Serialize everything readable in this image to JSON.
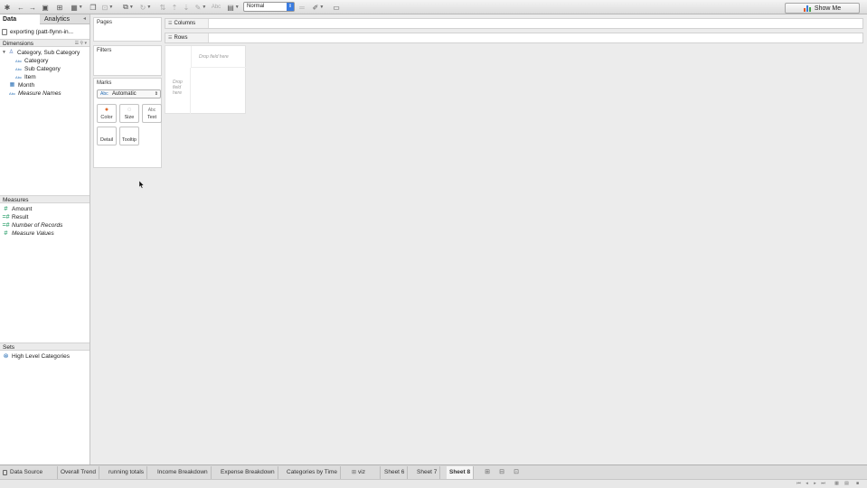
{
  "toolbar": {
    "fit_value": "Normal",
    "show_me_label": "Show Me",
    "abc_label": "Abc",
    "colors": {
      "accent": "#3b7ce0",
      "bar1": "#e05a2b",
      "bar2": "#3a7dd8",
      "bar3": "#4aa04a"
    }
  },
  "data_pane": {
    "tabs": [
      {
        "label": "Data"
      },
      {
        "label": "Analytics"
      }
    ],
    "datasource": "exporting (patt-flynn-in...",
    "dimensions_header": "Dimensions",
    "dimensions": [
      {
        "label": "Category, Sub Category",
        "icon": "hierarchy-icon"
      },
      {
        "label": "Category",
        "icon": "abc-icon"
      },
      {
        "label": "Sub Category",
        "icon": "abc-icon"
      },
      {
        "label": "Item",
        "icon": "abc-icon"
      },
      {
        "label": "Month",
        "icon": "calendar-icon"
      },
      {
        "label": "Measure Names",
        "icon": "abc-icon"
      }
    ],
    "abc_icon_text": "Abc",
    "measures_header": "Measures",
    "measures": [
      {
        "label": "Amount"
      },
      {
        "label": "Result"
      },
      {
        "label": "Number of Records"
      },
      {
        "label": "Measure Values"
      }
    ],
    "sets_header": "Sets",
    "sets": [
      {
        "label": "High Level Categories"
      }
    ]
  },
  "cards": {
    "pages_title": "Pages",
    "filters_title": "Filters",
    "marks_title": "Marks",
    "marks_type": "Automatic",
    "marks_type_prefix": "Abc",
    "mark_buttons": [
      {
        "label": "Color",
        "icon": "color-icon"
      },
      {
        "label": "Size",
        "icon": "size-icon"
      },
      {
        "label": "Text",
        "icon": "text-icon"
      },
      {
        "label": "Detail",
        "icon": "detail-icon"
      },
      {
        "label": "Tooltip",
        "icon": "tooltip-icon"
      }
    ],
    "text_icon_glyph": "Abc"
  },
  "shelves": {
    "columns_label": "Columns",
    "rows_label": "Rows"
  },
  "viz": {
    "drop_field_top": "Drop field here",
    "drop_field_left_1": "Drop",
    "drop_field_left_2": "field",
    "drop_field_left_3": "here"
  },
  "sheet_tabs": [
    {
      "label": "Data Source"
    },
    {
      "label": "Overall Trend"
    },
    {
      "label": "running totals"
    },
    {
      "label": "Income Breakdown"
    },
    {
      "label": "Expense Breakdown"
    },
    {
      "label": "Categories by Time"
    },
    {
      "label": "viz"
    },
    {
      "label": "Sheet 6"
    },
    {
      "label": "Sheet 7"
    },
    {
      "label": "Sheet 8"
    }
  ]
}
